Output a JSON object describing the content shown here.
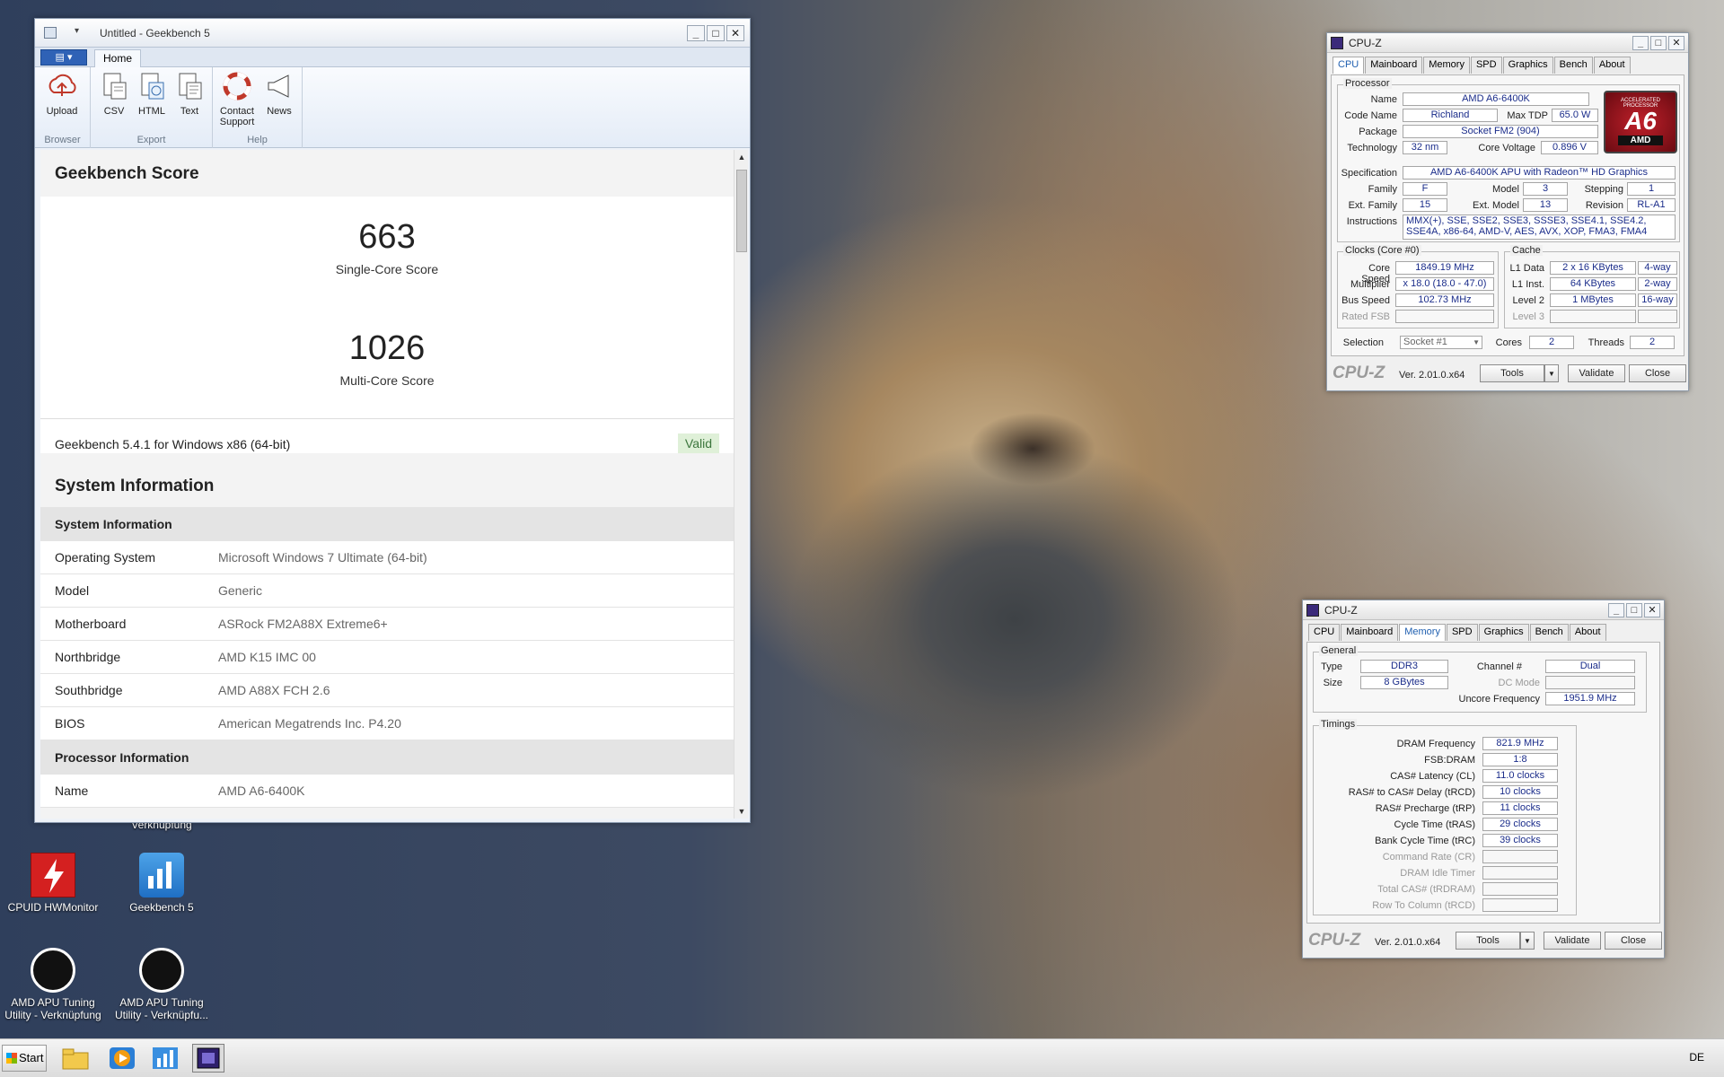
{
  "desktop": {
    "icons": [
      {
        "label": "CPUID HWMonitor"
      },
      {
        "label": "Geekbench 5"
      },
      {
        "label": "AMD APU Tuning Utility - Verknüpfung"
      },
      {
        "label": "AMD APU Tuning Utility - Verknüpfu..."
      },
      {
        "label": "Verknüpfung"
      }
    ]
  },
  "geekbench": {
    "title": "Untitled - Geekbench 5",
    "tabs": {
      "home": "Home"
    },
    "ribbon": {
      "groups": [
        "Browser",
        "Export",
        "Help"
      ],
      "upload": "Upload",
      "csv": "CSV",
      "html": "HTML",
      "text": "Text",
      "contact": "Contact Support",
      "news": "News"
    },
    "score_heading": "Geekbench Score",
    "single": {
      "value": "663",
      "label": "Single-Core Score"
    },
    "multi": {
      "value": "1026",
      "label": "Multi-Core Score"
    },
    "version": "Geekbench 5.4.1 for Windows x86 (64-bit)",
    "valid": "Valid",
    "sysinfo_heading": "System Information",
    "sysinfo_table_header": "System Information",
    "rows": [
      {
        "k": "Operating System",
        "v": "Microsoft Windows 7 Ultimate (64-bit)"
      },
      {
        "k": "Model",
        "v": "Generic"
      },
      {
        "k": "Motherboard",
        "v": "ASRock FM2A88X Extreme6+"
      },
      {
        "k": "Northbridge",
        "v": "AMD K15 IMC 00"
      },
      {
        "k": "Southbridge",
        "v": "AMD A88X FCH 2.6"
      },
      {
        "k": "BIOS",
        "v": "American Megatrends Inc. P4.20"
      }
    ],
    "proc_header": "Processor Information",
    "proc_rows": [
      {
        "k": "Name",
        "v": "AMD A6-6400K"
      }
    ]
  },
  "cpuz1": {
    "title": "CPU-Z",
    "tabs": [
      "CPU",
      "Mainboard",
      "Memory",
      "SPD",
      "Graphics",
      "Bench",
      "About"
    ],
    "processor_group": "Processor",
    "name_l": "Name",
    "name": "AMD A6-6400K",
    "codename_l": "Code Name",
    "codename": "Richland",
    "maxtdp_l": "Max TDP",
    "maxtdp": "65.0 W",
    "package_l": "Package",
    "package": "Socket FM2 (904)",
    "tech_l": "Technology",
    "tech": "32 nm",
    "corev_l": "Core Voltage",
    "corev": "0.896 V",
    "spec_l": "Specification",
    "spec": "AMD A6-6400K APU with Radeon™ HD Graphics",
    "family_l": "Family",
    "family": "F",
    "model_l": "Model",
    "model": "3",
    "stepping_l": "Stepping",
    "stepping": "1",
    "extfamily_l": "Ext. Family",
    "extfamily": "15",
    "extmodel_l": "Ext. Model",
    "extmodel": "13",
    "revision_l": "Revision",
    "revision": "RL-A1",
    "instr_l": "Instructions",
    "instr": "MMX(+), SSE, SSE2, SSE3, SSSE3, SSE4.1, SSE4.2, SSE4A, x86-64, AMD-V, AES, AVX, XOP, FMA3, FMA4",
    "logo": {
      "brand": "A6",
      "sub": "AMD",
      "tag": "ACCELERATED PROCESSOR"
    },
    "clocks_group": "Clocks (Core #0)",
    "corespeed_l": "Core Speed",
    "corespeed": "1849.19 MHz",
    "mult_l": "Multiplier",
    "mult": "x 18.0 (18.0 - 47.0)",
    "bus_l": "Bus Speed",
    "bus": "102.73 MHz",
    "fsb_l": "Rated FSB",
    "cache_group": "Cache",
    "l1d_l": "L1 Data",
    "l1d": "2 x 16 KBytes",
    "l1d_w": "4-way",
    "l1i_l": "L1 Inst.",
    "l1i": "64 KBytes",
    "l1i_w": "2-way",
    "l2_l": "Level 2",
    "l2": "1 MBytes",
    "l2_w": "16-way",
    "l3_l": "Level 3",
    "selection_l": "Selection",
    "selection": "Socket #1",
    "cores_l": "Cores",
    "cores": "2",
    "threads_l": "Threads",
    "threads": "2",
    "version": "Ver. 2.01.0.x64",
    "tools": "Tools",
    "validate": "Validate",
    "close": "Close",
    "mark": "CPU-Z"
  },
  "cpuz2": {
    "title": "CPU-Z",
    "tabs": [
      "CPU",
      "Mainboard",
      "Memory",
      "SPD",
      "Graphics",
      "Bench",
      "About"
    ],
    "general_group": "General",
    "type_l": "Type",
    "type": "DDR3",
    "channel_l": "Channel #",
    "channel": "Dual",
    "size_l": "Size",
    "size": "8 GBytes",
    "dcmode_l": "DC Mode",
    "uncore_l": "Uncore Frequency",
    "uncore": "1951.9 MHz",
    "timings_group": "Timings",
    "timings": [
      {
        "l": "DRAM Frequency",
        "v": "821.9 MHz"
      },
      {
        "l": "FSB:DRAM",
        "v": "1:8"
      },
      {
        "l": "CAS# Latency (CL)",
        "v": "11.0 clocks"
      },
      {
        "l": "RAS# to CAS# Delay (tRCD)",
        "v": "10 clocks"
      },
      {
        "l": "RAS# Precharge (tRP)",
        "v": "11 clocks"
      },
      {
        "l": "Cycle Time (tRAS)",
        "v": "29 clocks"
      },
      {
        "l": "Bank Cycle Time (tRC)",
        "v": "39 clocks"
      },
      {
        "l": "Command Rate (CR)",
        "v": ""
      },
      {
        "l": "DRAM Idle Timer",
        "v": ""
      },
      {
        "l": "Total CAS# (tRDRAM)",
        "v": ""
      },
      {
        "l": "Row To Column (tRCD)",
        "v": ""
      }
    ],
    "version": "Ver. 2.01.0.x64",
    "tools": "Tools",
    "validate": "Validate",
    "close": "Close",
    "mark": "CPU-Z"
  },
  "taskbar": {
    "start": "Start",
    "lang": "DE"
  }
}
